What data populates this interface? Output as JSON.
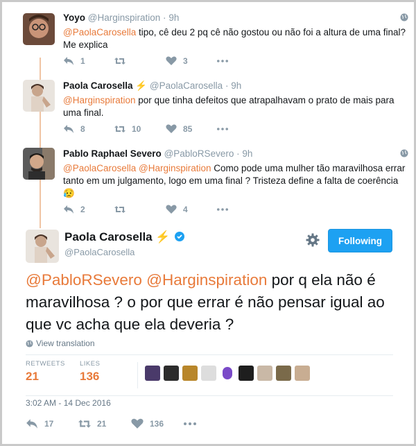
{
  "tweets": [
    {
      "name": "Yoyo",
      "handle": "@Harginspiration",
      "time": "9h",
      "mention": "@PaolaCarosella",
      "text": " tipo, cê deu 2 pq cê não gostou ou não foi a altura de uma final? Me explica",
      "replies": "1",
      "retweets": "",
      "likes": "3"
    },
    {
      "name": "Paola Carosella",
      "badge": "⚡",
      "handle": "@PaolaCarosella",
      "time": "9h",
      "mention": "@Harginspiration",
      "text": " por que tinha defeitos que atrapalhavam o prato de mais para uma final.",
      "replies": "8",
      "retweets": "10",
      "likes": "85"
    },
    {
      "name": "Pablo Raphael Severo",
      "handle": "@PabloRSevero",
      "time": "9h",
      "mention": "@PaolaCarosella @Harginspiration",
      "text": " Como pode uma mulher tão maravilhosa errar tanto em um julgamento, logo em uma final ? Tristeza define a falta de coerência 😥",
      "replies": "2",
      "retweets": "",
      "likes": "4"
    }
  ],
  "main": {
    "name": "Paola Carosella",
    "badge": "⚡",
    "handle": "@PaolaCarosella",
    "follow_label": "Following",
    "mentions": "@PabloRSevero @Harginspiration",
    "text": " por q ela não é maravilhosa ?  o por que errar é não pensar igual ao que vc acha que ela deveria ?",
    "view_translation": "View translation",
    "retweets_label": "RETWEETS",
    "retweets": "21",
    "likes_label": "LIKES",
    "likes": "136",
    "timestamp": "3:02 AM - 14 Dec 2016",
    "action_replies": "17",
    "action_retweets": "21",
    "action_likes": "136"
  },
  "colors": {
    "accent": "#e87a3a",
    "follow_button": "#1da1f2",
    "thread_line": "#f0c4a4",
    "muted": "#8899a6",
    "badge": "#f7b400"
  },
  "icons": [
    "reply-icon",
    "retweet-icon",
    "heart-icon",
    "more-icon",
    "globe-icon",
    "gear-icon",
    "verified-icon"
  ]
}
